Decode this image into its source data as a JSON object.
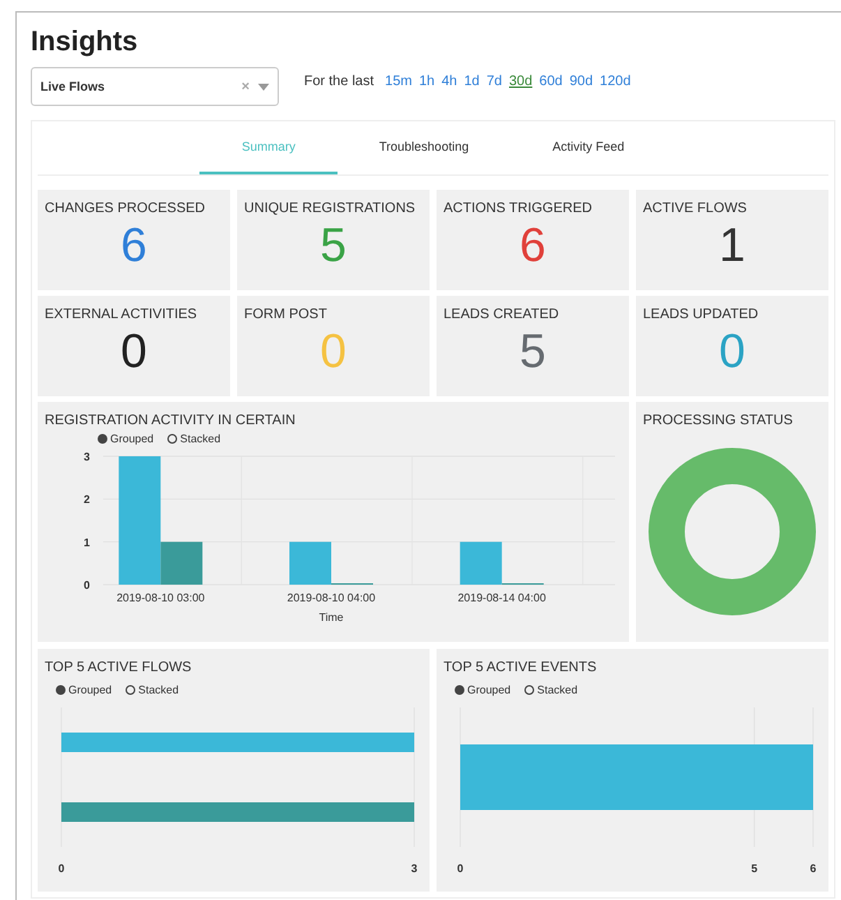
{
  "page": {
    "title": "Insights"
  },
  "flow_select": {
    "value": "Live Flows",
    "clear": "×"
  },
  "time_range": {
    "label": "For the last",
    "options": [
      {
        "label": "15m",
        "selected": false
      },
      {
        "label": "1h",
        "selected": false
      },
      {
        "label": "4h",
        "selected": false
      },
      {
        "label": "1d",
        "selected": false
      },
      {
        "label": "7d",
        "selected": false
      },
      {
        "label": "30d",
        "selected": true
      },
      {
        "label": "60d",
        "selected": false
      },
      {
        "label": "90d",
        "selected": false
      },
      {
        "label": "120d",
        "selected": false
      }
    ]
  },
  "tabs": [
    {
      "label": "Summary",
      "selected": true
    },
    {
      "label": "Troubleshooting",
      "selected": false
    },
    {
      "label": "Activity Feed",
      "selected": false
    }
  ],
  "stats": [
    {
      "label": "CHANGES PROCESSED",
      "value": "6",
      "color": "#2f7fd8"
    },
    {
      "label": "UNIQUE REGISTRATIONS",
      "value": "5",
      "color": "#3aa346"
    },
    {
      "label": "ACTIONS TRIGGERED",
      "value": "6",
      "color": "#e0403a"
    },
    {
      "label": "ACTIVE FLOWS",
      "value": "1",
      "color": "#333333"
    },
    {
      "label": "EXTERNAL ACTIVITIES",
      "value": "0",
      "color": "#222222"
    },
    {
      "label": "FORM POST",
      "value": "0",
      "color": "#f5c242"
    },
    {
      "label": "LEADS CREATED",
      "value": "5",
      "color": "#666b70"
    },
    {
      "label": "LEADS UPDATED",
      "value": "0",
      "color": "#2ba3c4"
    }
  ],
  "registration_activity": {
    "title": "REGISTRATION ACTIVITY IN CERTAIN",
    "legend": [
      {
        "label": "Grouped",
        "selected": true
      },
      {
        "label": "Stacked",
        "selected": false
      }
    ],
    "chart_data": {
      "type": "bar",
      "xlabel": "Time",
      "categories": [
        "2019-08-10 03:00",
        "2019-08-10 04:00",
        "2019-08-14 04:00"
      ],
      "series": [
        {
          "color": "#3bb8d8",
          "values": [
            3,
            1,
            1
          ]
        },
        {
          "color": "#3a9b9a",
          "values": [
            1,
            0,
            0
          ]
        }
      ],
      "ylim": [
        0,
        3
      ],
      "yticks": [
        0,
        1,
        2,
        3
      ]
    }
  },
  "processing_status": {
    "title": "PROCESSING STATUS"
  },
  "top_flows": {
    "title": "TOP 5 ACTIVE FLOWS",
    "legend": [
      {
        "label": "Grouped",
        "selected": true
      },
      {
        "label": "Stacked",
        "selected": false
      }
    ],
    "chart_data": {
      "type": "bar",
      "orientation": "horizontal",
      "series": [
        {
          "color": "#3bb8d8",
          "values": [
            3
          ]
        },
        {
          "color": "#3a9b9a",
          "values": [
            3
          ]
        }
      ],
      "xlim": [
        0,
        3
      ],
      "xticks": [
        0,
        3
      ]
    }
  },
  "top_events": {
    "title": "TOP 5 ACTIVE EVENTS",
    "legend": [
      {
        "label": "Grouped",
        "selected": true
      },
      {
        "label": "Stacked",
        "selected": false
      }
    ],
    "chart_data": {
      "type": "bar",
      "orientation": "horizontal",
      "series": [
        {
          "color": "#3bb8d8",
          "values": [
            6
          ]
        }
      ],
      "xlim": [
        0,
        6
      ],
      "xticks": [
        0,
        5,
        6
      ]
    }
  }
}
